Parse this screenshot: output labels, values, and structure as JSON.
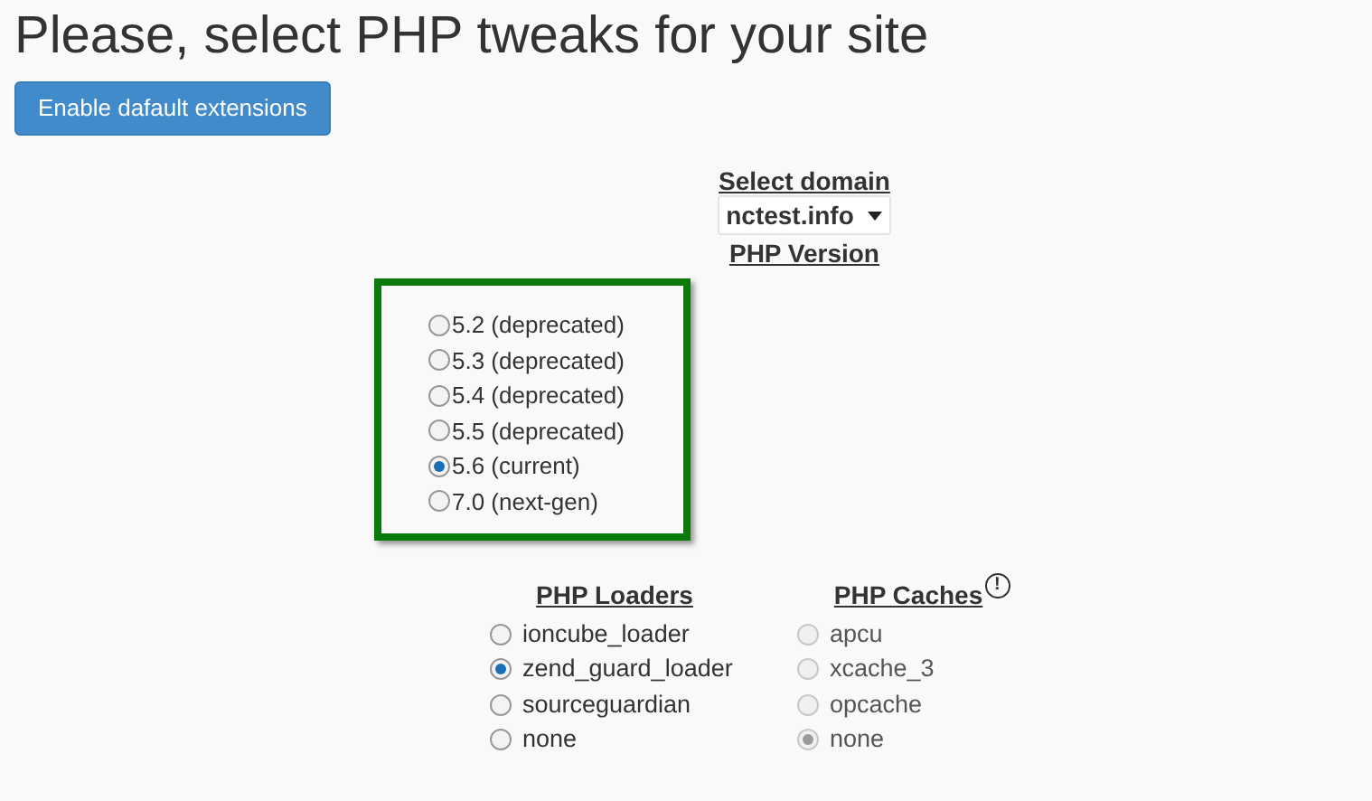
{
  "title": "Please, select PHP tweaks for your site",
  "enable_button": "Enable dafault extensions",
  "domain": {
    "label": "Select domain",
    "value": "nctest.info"
  },
  "php_version": {
    "label": "PHP Version",
    "options": [
      {
        "label": "5.2 (deprecated)",
        "selected": false
      },
      {
        "label": "5.3 (deprecated)",
        "selected": false
      },
      {
        "label": "5.4 (deprecated)",
        "selected": false
      },
      {
        "label": "5.5 (deprecated)",
        "selected": false
      },
      {
        "label": "5.6 (current)",
        "selected": true
      },
      {
        "label": "7.0 (next-gen)",
        "selected": false
      }
    ]
  },
  "loaders": {
    "label": "PHP Loaders",
    "options": [
      {
        "label": "ioncube_loader",
        "selected": false,
        "disabled": false
      },
      {
        "label": "zend_guard_loader",
        "selected": true,
        "disabled": false
      },
      {
        "label": "sourceguardian",
        "selected": false,
        "disabled": false
      },
      {
        "label": "none",
        "selected": false,
        "disabled": false
      }
    ]
  },
  "caches": {
    "label": "PHP Caches",
    "info_icon": "!",
    "options": [
      {
        "label": "apcu",
        "selected": false,
        "disabled": true
      },
      {
        "label": "xcache_3",
        "selected": false,
        "disabled": true
      },
      {
        "label": "opcache",
        "selected": false,
        "disabled": true
      },
      {
        "label": "none",
        "selected": true,
        "disabled": true
      }
    ]
  }
}
